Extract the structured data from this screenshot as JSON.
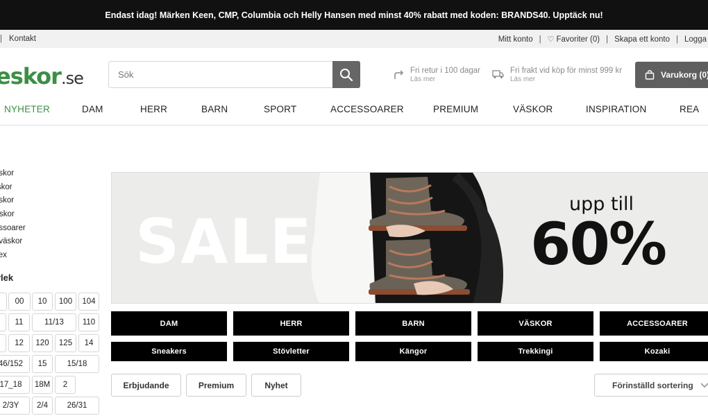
{
  "promo": {
    "text": "Endast idag! Märken Keen, CMP, Columbia och Helly Hansen med minst 40% rabatt med koden: BRANDS40. Upptäck nu!"
  },
  "util": {
    "left_sep": "|",
    "contact": "Kontakt",
    "my_account": "Mitt konto",
    "favorites": "Favoriter (0)",
    "create_account": "Skapa ett konto",
    "login": "Logga",
    "sep": "|"
  },
  "logo": {
    "main": "eskor",
    "tld": ".se"
  },
  "search": {
    "placeholder": "Sök"
  },
  "benefits": [
    {
      "main": "Fri retur i 100 dagar",
      "sub": "Läs mer",
      "icon": "return-arrow-icon"
    },
    {
      "main": "Fri frakt vid köp för minst 999 kr",
      "sub": "Läs mer",
      "icon": "truck-icon"
    }
  ],
  "cart": {
    "label": "Varukorg (0)",
    "icon": "bag-icon"
  },
  "nav": [
    "NYHETER",
    "DAM",
    "HERR",
    "BARN",
    "SPORT",
    "ACCESSOARER",
    "PREMIUM",
    "VÄSKOR",
    "INSPIRATION",
    "REA"
  ],
  "filters": {
    "categories": [
      "nskor",
      "rskor",
      "nskor",
      "rtskor",
      "essoarer",
      "dväskor",
      "sex"
    ],
    "size_heading": "rlek",
    "sizes": [
      "",
      "00",
      "10",
      "100",
      "104",
      "5",
      "11",
      "11/13",
      "110",
      "5",
      "12",
      "120",
      "125",
      "14",
      "46/152",
      "15",
      "15/18",
      "17_18",
      "18M",
      "2",
      "2/3Y",
      "2/4",
      "26/31"
    ]
  },
  "banner": {
    "sale": "SALE",
    "upto": "upp till",
    "percent": "60%"
  },
  "category_buttons": [
    "DAM",
    "HERR",
    "BARN",
    "VÄSKOR",
    "ACCESSOARER"
  ],
  "sub_buttons": [
    "Sneakers",
    "Stövletter",
    "Kängor",
    "Trekkingi",
    "Kozaki"
  ],
  "chips": [
    "Erbjudande",
    "Premium",
    "Nyhet"
  ],
  "sort": {
    "label": "Förinställd sortering"
  },
  "colors": {
    "brand_green": "#3c8f45",
    "dark": "#111111",
    "cart_grey": "#5f5f5f"
  }
}
